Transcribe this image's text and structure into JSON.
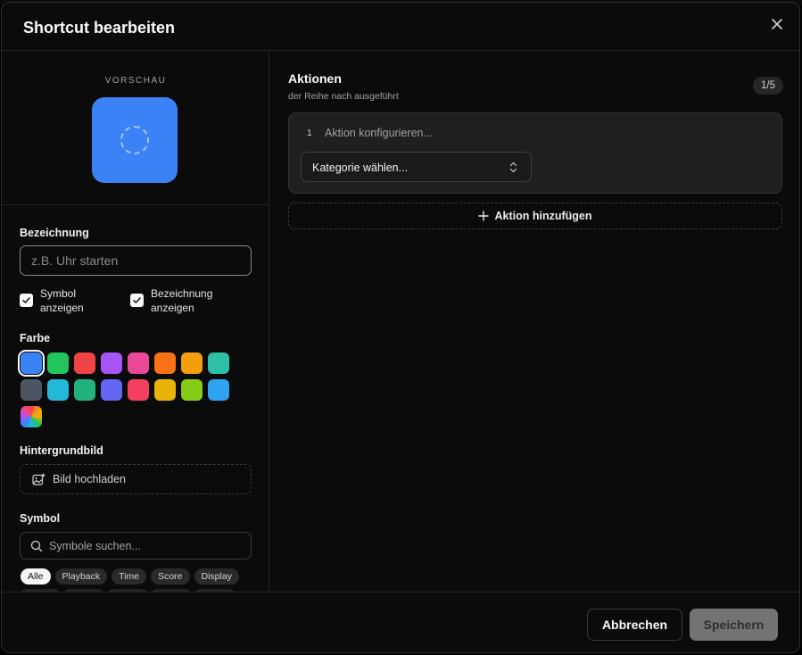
{
  "modal": {
    "title": "Shortcut bearbeiten"
  },
  "preview": {
    "label": "VORSCHAU",
    "tile_color": "#3b82f6"
  },
  "form": {
    "name_label": "Bezeichnung",
    "name_placeholder": "z.B. Uhr starten",
    "name_value": "",
    "show_symbol_label": "Symbol anzeigen",
    "show_symbol_checked": true,
    "show_name_label": "Bezeichnung anzeigen",
    "show_name_checked": true,
    "color_label": "Farbe",
    "colors": [
      "#3b82f6",
      "#22c55e",
      "#ef4444",
      "#a855f7",
      "#ec4899",
      "#f97316",
      "#f59e0b",
      "#2dbfa8",
      "#4b5563",
      "#22b8d8",
      "#22b07d",
      "#6366f1",
      "#f43f5e",
      "#eab308",
      "#84cc16",
      "#2ea3ef"
    ],
    "selected_color": "#3b82f6",
    "background_label": "Hintergrundbild",
    "upload_label": "Bild hochladen",
    "symbol_label": "Symbol",
    "symbol_search_placeholder": "Symbole suchen...",
    "symbol_categories": [
      "Alle",
      "Playback",
      "Time",
      "Score",
      "Display"
    ],
    "active_symbol_category": "Alle"
  },
  "actions": {
    "title": "Aktionen",
    "subtitle": "der Reihe nach ausgeführt",
    "count": "1/5",
    "items": [
      {
        "number": "1",
        "placeholder": "Aktion konfigurieren...",
        "category": "Kategorie wählen..."
      }
    ],
    "add_label": "Aktion hinzufügen"
  },
  "footer": {
    "cancel_label": "Abbrechen",
    "save_label": "Speichern"
  }
}
